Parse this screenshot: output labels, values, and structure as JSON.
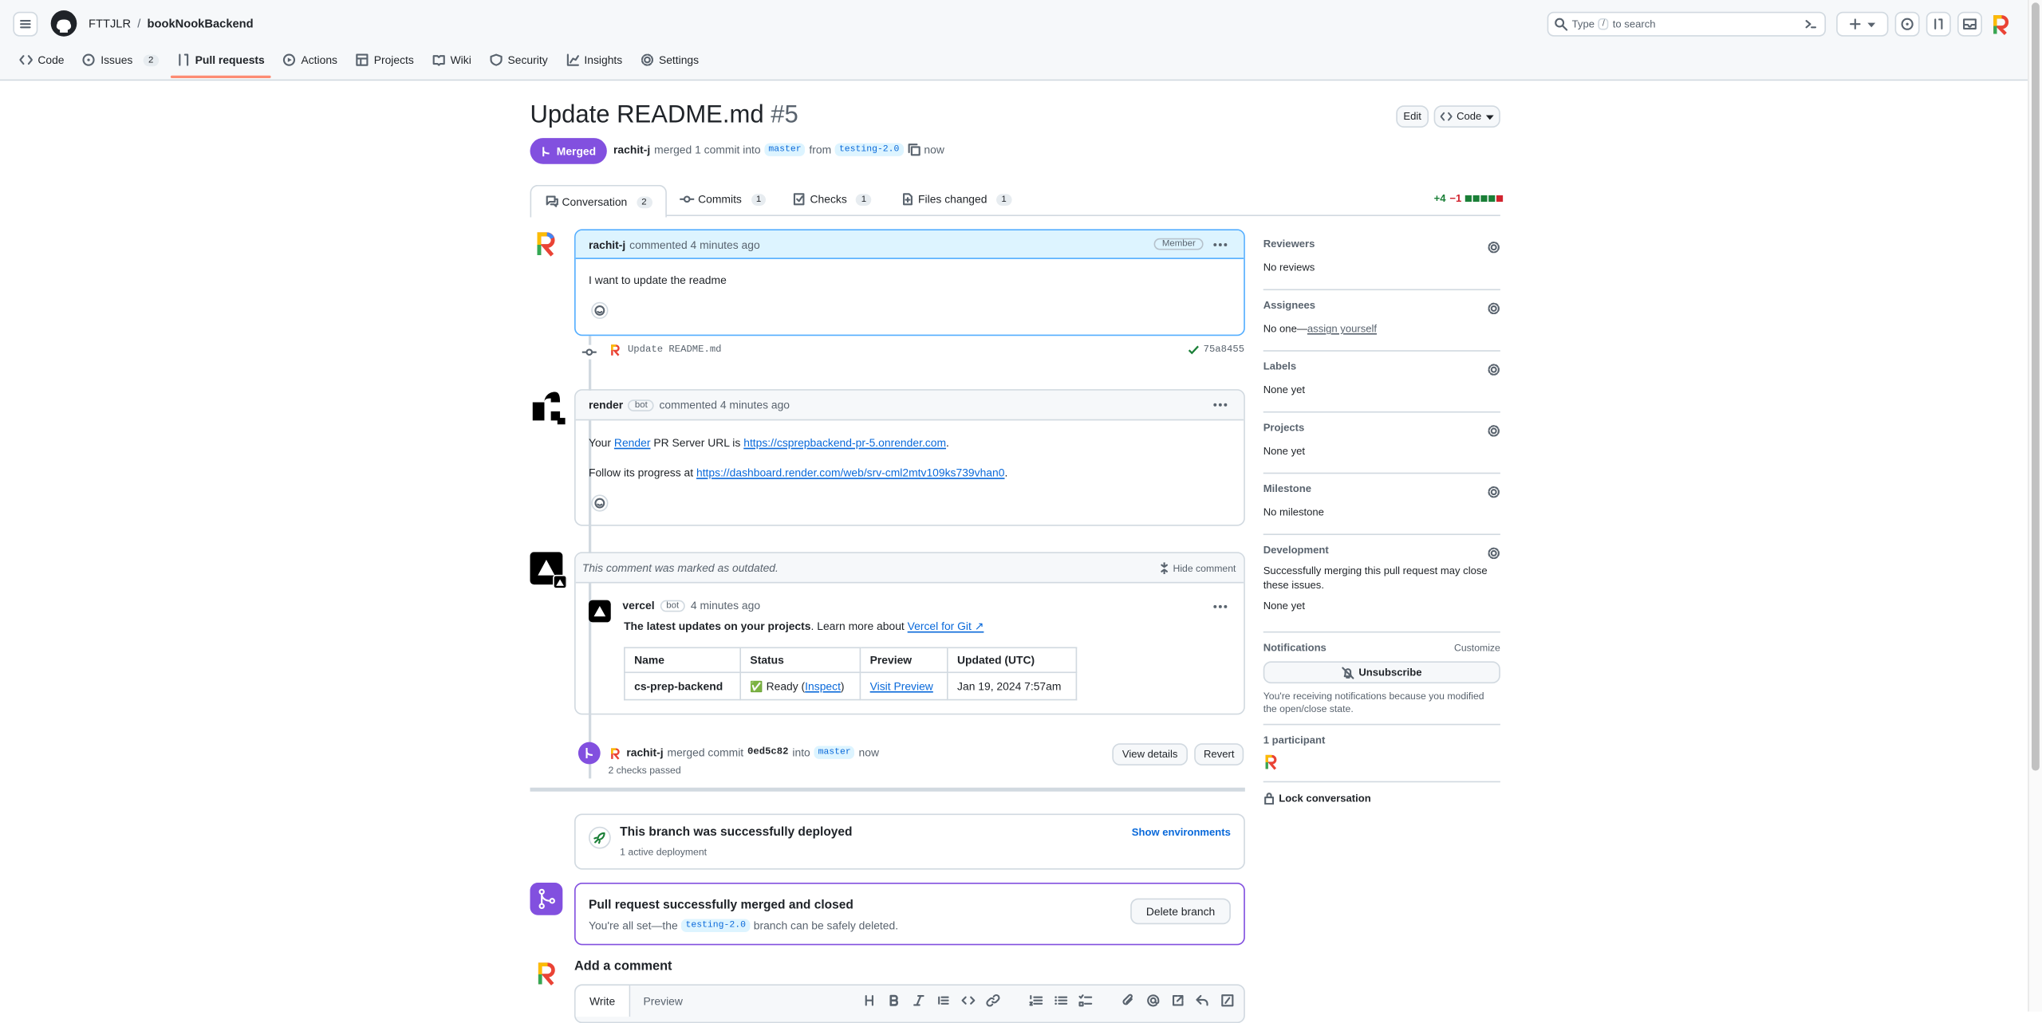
{
  "header": {
    "owner": "FTTJLR",
    "separator": "/",
    "repo": "bookNookBackend",
    "search_pre": "Type",
    "search_key": "/",
    "search_post": "to search"
  },
  "repo_nav": [
    {
      "label": "Code",
      "count": null
    },
    {
      "label": "Issues",
      "count": "2"
    },
    {
      "label": "Pull requests",
      "count": null
    },
    {
      "label": "Actions",
      "count": null
    },
    {
      "label": "Projects",
      "count": null
    },
    {
      "label": "Wiki",
      "count": null
    },
    {
      "label": "Security",
      "count": null
    },
    {
      "label": "Insights",
      "count": null
    },
    {
      "label": "Settings",
      "count": null
    }
  ],
  "pr": {
    "title": "Update README.md",
    "number": "#5",
    "state": "Merged",
    "author": "rachit-j",
    "merged_text": "merged 1 commit into",
    "base": "master",
    "from": "from",
    "head": "testing-2.0",
    "time": "now",
    "edit": "Edit",
    "code": "Code"
  },
  "tabs": [
    {
      "label": "Conversation",
      "count": "2"
    },
    {
      "label": "Commits",
      "count": "1"
    },
    {
      "label": "Checks",
      "count": "1"
    },
    {
      "label": "Files changed",
      "count": "1"
    }
  ],
  "diffstat": {
    "add": "+4",
    "del": "−1"
  },
  "comment1": {
    "author": "rachit-j",
    "meta": "commented 4 minutes ago",
    "badge": "Member",
    "body": "I want to update the readme"
  },
  "commit": {
    "message": "Update README.md",
    "sha": "75a8455"
  },
  "comment2": {
    "author": "render",
    "bot": "bot",
    "meta": "commented 4 minutes ago",
    "p1_pre": "Your",
    "p1_link1": "Render",
    "p1_mid": "PR Server URL is",
    "p1_link2": "https://csprepbackend-pr-5.onrender.com",
    "p1_end": ".",
    "p2_pre": "Follow its progress at",
    "p2_link": "https://dashboard.render.com/web/srv-cml2mtv109ks739vhan0",
    "p2_end": "."
  },
  "comment3": {
    "outdated": "This comment was marked as outdated.",
    "hide": "Hide comment",
    "author": "vercel",
    "bot": "bot",
    "time": "4 minutes ago",
    "intro_bold": "The latest updates on your projects",
    "intro_rest": ". Learn more about",
    "intro_link": "Vercel for Git ↗",
    "table": {
      "headers": [
        "Name",
        "Status",
        "Preview",
        "Updated (UTC)"
      ],
      "row": {
        "name": "cs-prep-backend",
        "status_icon": "✅",
        "status": "Ready (",
        "inspect": "Inspect",
        "status_end": ")",
        "preview": "Visit Preview",
        "updated": "Jan 19, 2024 7:57am"
      }
    }
  },
  "merge_event": {
    "author": "rachit-j",
    "text": "merged commit",
    "sha": "0ed5c82",
    "into": "into",
    "base": "master",
    "time": "now",
    "checks": "2 checks passed",
    "view": "View details",
    "revert": "Revert"
  },
  "deploy": {
    "title": "This branch was successfully deployed",
    "sub": "1 active deployment",
    "link": "Show environments"
  },
  "merged_box": {
    "title": "Pull request successfully merged and closed",
    "sub_pre": "You're all set—the",
    "branch": "testing-2.0",
    "sub_post": "branch can be safely deleted.",
    "button": "Delete branch"
  },
  "add_comment": {
    "title": "Add a comment",
    "write": "Write",
    "preview": "Preview"
  },
  "sidebar": {
    "reviewers_h": "Reviewers",
    "reviewers_v": "No reviews",
    "assignees_h": "Assignees",
    "assignees_v": "No one—",
    "assignees_link": "assign yourself",
    "labels_h": "Labels",
    "labels_v": "None yet",
    "projects_h": "Projects",
    "projects_v": "None yet",
    "milestone_h": "Milestone",
    "milestone_v": "No milestone",
    "dev_h": "Development",
    "dev_v": "Successfully merging this pull request may close these issues.",
    "dev_v2": "None yet",
    "notif_h": "Notifications",
    "notif_custom": "Customize",
    "unsubscribe": "Unsubscribe",
    "notif_note": "You're receiving notifications because you modified the open/close state.",
    "participants": "1 participant",
    "lock": "Lock conversation"
  },
  "colors": {
    "merged": "#8250df",
    "link": "#0969da",
    "green": "#1a7f37",
    "red": "#d1242f"
  }
}
